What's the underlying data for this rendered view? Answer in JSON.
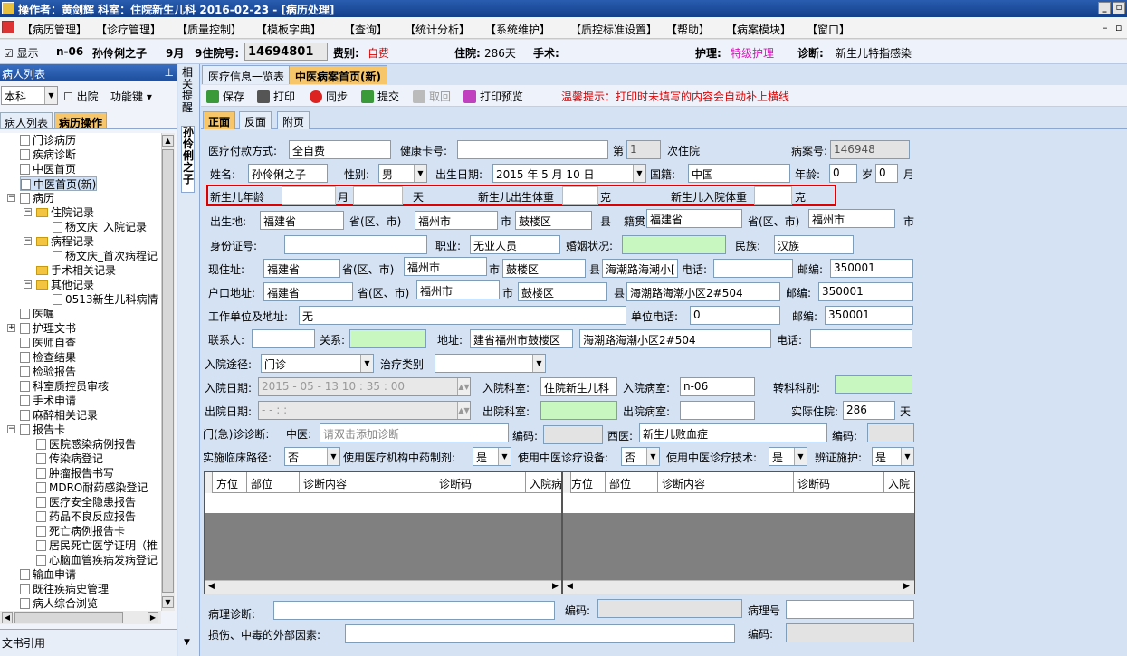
{
  "titlebar": {
    "title": "操作者：黄剑辉  科室：住院新生儿科  2016-02-23 - [病历处理]"
  },
  "menu": [
    "【病历管理】",
    "【诊疗管理】",
    "【质量控制】",
    "【模板字典】",
    "【查询】",
    "【统计分析】",
    "【系统维护】",
    "【质控标准设置】",
    "【帮助】",
    "【病案模块】",
    "【窗口】"
  ],
  "patient": {
    "show_label": "显示",
    "bed": "n-06",
    "name": "孙伶俐之子",
    "age": "9月",
    "inpatient_no_label": "9住院号:",
    "inpatient_no": "14694801",
    "fee_label": "费别:",
    "fee": "自费",
    "stay_label": "住院:",
    "stay": "286天",
    "surgery_label": "手术:",
    "nursing_label": "护理:",
    "nursing": "特级护理",
    "diagnosis_label": "诊断:",
    "diagnosis": "新生儿特指感染"
  },
  "left": {
    "header": "病人列表",
    "pin": "ᵽ",
    "dept_select": "本科",
    "discharged_label": "出院",
    "func_key": "功能键",
    "tabs": [
      "病人列表",
      "病历操作"
    ],
    "footer": "文书引用",
    "tree": [
      {
        "label": "门诊病历",
        "level": 1
      },
      {
        "label": "疾病诊断",
        "level": 1
      },
      {
        "label": "中医首页",
        "level": 1
      },
      {
        "label": "中医首页(新)",
        "level": 1
      },
      {
        "label": "病历",
        "level": 1
      },
      {
        "label": "住院记录",
        "level": 2
      },
      {
        "label": "杨文庆_入院记录",
        "level": 3
      },
      {
        "label": "病程记录",
        "level": 2
      },
      {
        "label": "杨文庆_首次病程记",
        "level": 3
      },
      {
        "label": "手术相关记录",
        "level": 2
      },
      {
        "label": "其他记录",
        "level": 2
      },
      {
        "label": "0513新生儿科病情",
        "level": 3
      },
      {
        "label": "医嘱",
        "level": 1
      },
      {
        "label": "护理文书",
        "level": 1
      },
      {
        "label": "医师自查",
        "level": 1
      },
      {
        "label": "检查结果",
        "level": 1
      },
      {
        "label": "检验报告",
        "level": 1
      },
      {
        "label": "科室质控员审核",
        "level": 1
      },
      {
        "label": "手术申请",
        "level": 1
      },
      {
        "label": "麻醉相关记录",
        "level": 1
      },
      {
        "label": "报告卡",
        "level": 1
      },
      {
        "label": "医院感染病例报告",
        "level": 2
      },
      {
        "label": "传染病登记",
        "level": 2
      },
      {
        "label": "肿瘤报告书写",
        "level": 2
      },
      {
        "label": "MDRO耐药感染登记",
        "level": 2
      },
      {
        "label": "医疗安全隐患报告",
        "level": 2
      },
      {
        "label": "药品不良反应报告",
        "level": 2
      },
      {
        "label": "死亡病例报告卡",
        "level": 2
      },
      {
        "label": "居民死亡医学证明（推",
        "level": 2
      },
      {
        "label": "心脑血管疾病发病登记",
        "level": 2
      },
      {
        "label": "输血申请",
        "level": 1
      },
      {
        "label": "既往疾病史管理",
        "level": 1
      },
      {
        "label": "病人综合浏览",
        "level": 1
      }
    ]
  },
  "vtabs": {
    "related": "相关提醒",
    "patient": "孙伶俐之子"
  },
  "tabs": [
    "医疗信息一览表",
    "中医病案首页(新)"
  ],
  "toolbar": {
    "save": "保存",
    "print": "打印",
    "sync": "同步",
    "submit": "提交",
    "withdraw": "取回",
    "preview": "打印预览",
    "hint": "温馨提示：打印时未填写的内容会自动补上横线"
  },
  "subtabs": [
    "正面",
    "反面",
    "附页"
  ],
  "form": {
    "pay_label": "医疗付款方式:",
    "pay": "全自费",
    "card_label": "健康卡号:",
    "card": "",
    "nth_label": "第",
    "nth": "1",
    "nth_suffix": "次住院",
    "case_no_label": "病案号:",
    "case_no": "146948",
    "name_label": "姓名:",
    "name": "孙伶俐之子",
    "sex_label": "性别:",
    "sex": "男",
    "dob_label": "出生日期:",
    "dob": "2015 年 5 月 10 日",
    "nation_label": "国籍:",
    "nation": "中国",
    "age_label": "年龄:",
    "age_y": "0",
    "age_y_unit": "岁",
    "age_m": "0",
    "age_m_unit": "月",
    "nb_age_label": "新生儿年龄",
    "nb_month": "月",
    "nb_day": "天",
    "nb_bw_label": "新生儿出生体重",
    "nb_bw_unit": "克",
    "nb_iw_label": "新生儿入院体重",
    "nb_iw_unit": "克",
    "birth_label": "出生地:",
    "birth_prov": "福建省",
    "prov_unit": "省(区、市)",
    "birth_city": "福州市",
    "city_unit": "市",
    "birth_county": "鼓楼区",
    "county_unit": "县",
    "origin_label": "籍贯",
    "origin_prov": "福建省",
    "origin_city": "福州市",
    "id_label": "身份证号:",
    "id": "",
    "job_label": "职业:",
    "job": "无业人员",
    "marital_label": "婚姻状况:",
    "marital": "",
    "ethnic_label": "民族:",
    "ethnic": "汉族",
    "addr_label": "现住址:",
    "addr_prov": "福建省",
    "addr_city": "福州市",
    "addr_county": "鼓楼区",
    "addr_detail": "海潮路海潮小[",
    "phone_label": "电话:",
    "phone": "",
    "zip_label": "邮编:",
    "zip": "350001",
    "hukou_label": "户口地址:",
    "hukou_prov": "福建省",
    "hukou_city": "福州市",
    "hukou_county": "鼓楼区",
    "hukou_detail": "海潮路海潮小区2#504",
    "hukou_zip": "350001",
    "work_label": "工作单位及地址:",
    "work": "无",
    "work_phone_label": "单位电话:",
    "work_phone": "0",
    "work_zip": "350001",
    "contact_label": "联系人:",
    "contact": "",
    "relation_label": "关系:",
    "relation": "",
    "contact_addr_label": "地址:",
    "contact_addr1": "建省福州市鼓楼区",
    "contact_addr2": "海潮路海潮小区2#504",
    "contact_phone_label": "电话:",
    "contact_phone": "",
    "route_label": "入院途径:",
    "route": "门诊",
    "treat_label": "治疗类别",
    "treat": "",
    "adm_date_label": "入院日期:",
    "adm_date": "2015 - 05 - 13   10 : 35 : 00",
    "adm_dept_label": "入院科室:",
    "adm_dept": "住院新生儿科",
    "adm_ward_label": "入院病室:",
    "adm_ward": "n-06",
    "transfer_label": "转科科别:",
    "transfer": "",
    "dis_date_label": "出院日期:",
    "dis_date": "-  -       :   :",
    "dis_dept_label": "出院科室:",
    "dis_dept": "",
    "dis_ward_label": "出院病室:",
    "dis_ward": "",
    "actual_label": "实际住院:",
    "actual": "286",
    "actual_unit": "天",
    "op_diag_label": "门(急)诊诊断:",
    "tcm_label": "中医:",
    "tcm_ph": "请双击添加诊断",
    "code_label": "编码:",
    "tcm_code": "",
    "wm_label": "西医:",
    "wm": "新生儿败血症",
    "wm_code": "",
    "path_label": "实施临床路径:",
    "path": "否",
    "herb_label": "使用医疗机构中药制剂:",
    "herb": "是",
    "equip_label": "使用中医诊疗设备:",
    "equip": "否",
    "tech_label": "使用中医诊疗技术:",
    "tech": "是",
    "syn_label": "辨证施护:",
    "syn": "是",
    "grid_cols": [
      "方位",
      "部位",
      "诊断内容",
      "诊断码",
      "入院病"
    ],
    "grid_cols2": [
      "方位",
      "部位",
      "诊断内容",
      "诊断码",
      "入院"
    ],
    "path_diag_label": "病理诊断:",
    "path_diag": "",
    "path_code": "",
    "path_no_label": "病理号",
    "path_no": "",
    "injury_label": "损伤、中毒的外部因素:",
    "injury": "",
    "injury_code": ""
  }
}
